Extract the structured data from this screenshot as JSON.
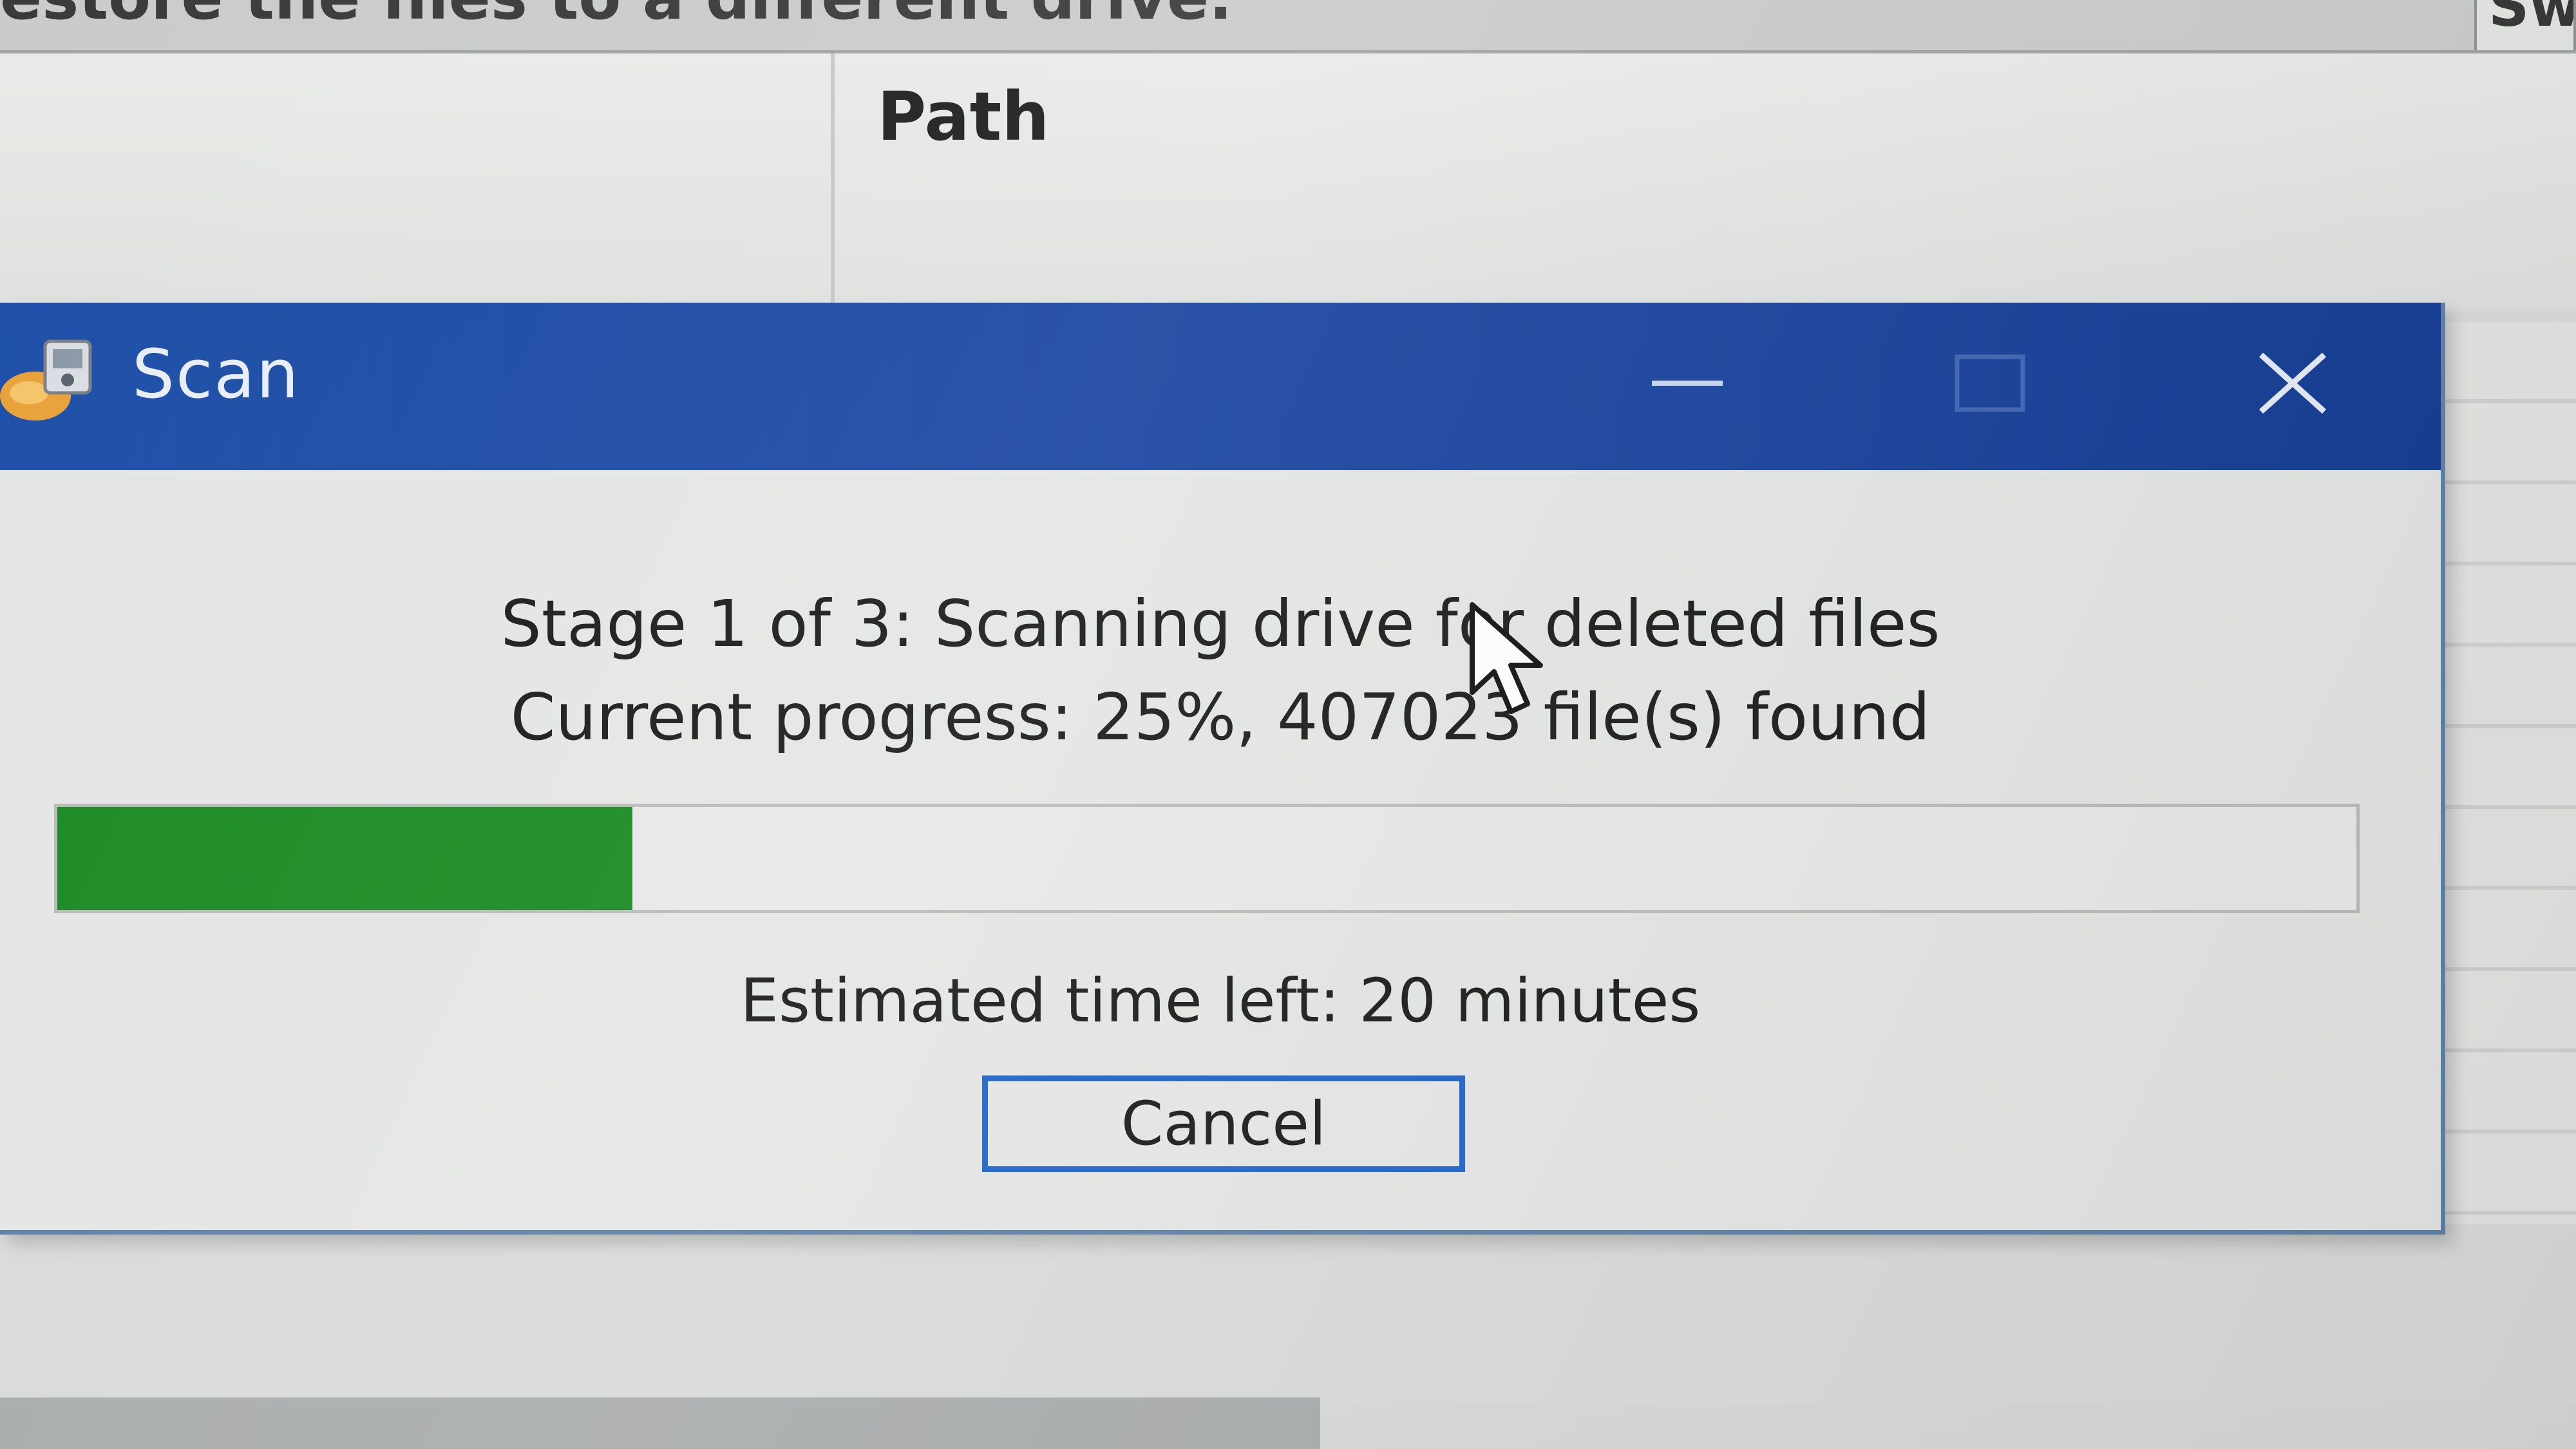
{
  "background_window": {
    "top_text": "estore the files to a different drive.",
    "top_button_label": "Sw",
    "column_header_path": "Path"
  },
  "dialog": {
    "title": "Scan",
    "app_icon": "recovery-app-icon",
    "titlebar_buttons": [
      "minimize-icon",
      "maximize-icon",
      "close-icon"
    ],
    "stage_text": "Stage 1 of 3: Scanning drive for deleted files",
    "progress_text": "Current progress: 25%, 407023 file(s) found",
    "progress": {
      "percent": 25,
      "files_found": 407023,
      "fill_color": "#1a8a22"
    },
    "estimate_text": "Estimated time left: 20 minutes",
    "cancel_label": "Cancel",
    "accent_color": "#1e4fa8"
  }
}
